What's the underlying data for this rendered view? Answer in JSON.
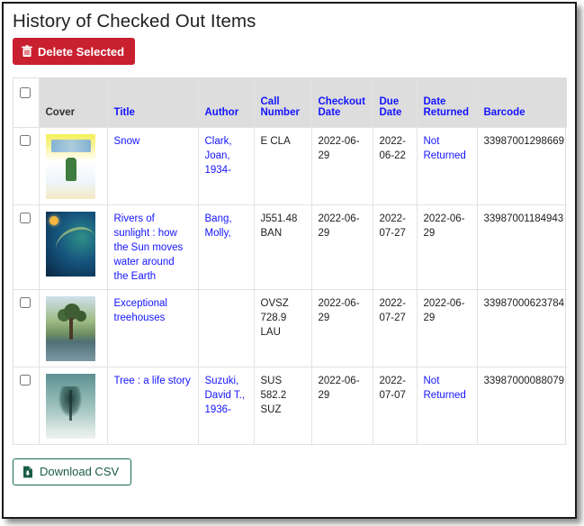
{
  "page": {
    "title": "History of Checked Out Items"
  },
  "toolbar": {
    "delete_label": "Delete Selected",
    "delete_icon": "trash-icon",
    "download_label": "Download CSV",
    "download_icon": "file-download-icon",
    "delete_color": "#c9202f",
    "download_color": "#1a6b4f"
  },
  "table": {
    "select_all_checked": false,
    "columns": [
      {
        "key": "select",
        "label": "",
        "link": false
      },
      {
        "key": "cover",
        "label": "Cover",
        "link": false
      },
      {
        "key": "title",
        "label": "Title",
        "link": true
      },
      {
        "key": "author",
        "label": "Author",
        "link": true
      },
      {
        "key": "call",
        "label": "Call Number",
        "link": true
      },
      {
        "key": "checkout",
        "label": "Checkout Date",
        "link": true
      },
      {
        "key": "due",
        "label": "Due Date",
        "link": true
      },
      {
        "key": "returned",
        "label": "Date Returned",
        "link": true
      },
      {
        "key": "barcode",
        "label": "Barcode",
        "link": true
      }
    ],
    "rows": [
      {
        "checked": false,
        "cover_art": "snow",
        "cover_alt": "Snow book cover",
        "title": "Snow",
        "author": "Clark, Joan, 1934-",
        "call_number": "E CLA",
        "checkout_date": "2022-06-29",
        "due_date": "2022-06-22",
        "date_returned": "Not Returned",
        "returned_is_link": true,
        "barcode": "33987001298669"
      },
      {
        "checked": false,
        "cover_art": "rivers",
        "cover_alt": "Rivers of sunlight book cover",
        "title": "Rivers of sunlight : how the Sun moves water around the Earth",
        "author": "Bang, Molly,",
        "call_number": "J551.48 BAN",
        "checkout_date": "2022-06-29",
        "due_date": "2022-07-27",
        "date_returned": "2022-06-29",
        "returned_is_link": false,
        "barcode": "33987001184943"
      },
      {
        "checked": false,
        "cover_art": "treehouse",
        "cover_alt": "Exceptional treehouses book cover",
        "title": "Exceptional treehouses",
        "author": "",
        "call_number": "OVSZ 728.9 LAU",
        "checkout_date": "2022-06-29",
        "due_date": "2022-07-27",
        "date_returned": "2022-06-29",
        "returned_is_link": false,
        "barcode": "33987000623784"
      },
      {
        "checked": false,
        "cover_art": "tree",
        "cover_alt": "Tree : a life story book cover",
        "title": "Tree : a life story",
        "author": "Suzuki, David T., 1936-",
        "call_number": "SUS 582.2 SUZ",
        "checkout_date": "2022-06-29",
        "due_date": "2022-07-07",
        "date_returned": "Not Returned",
        "returned_is_link": true,
        "barcode": "33987000088079"
      }
    ]
  }
}
